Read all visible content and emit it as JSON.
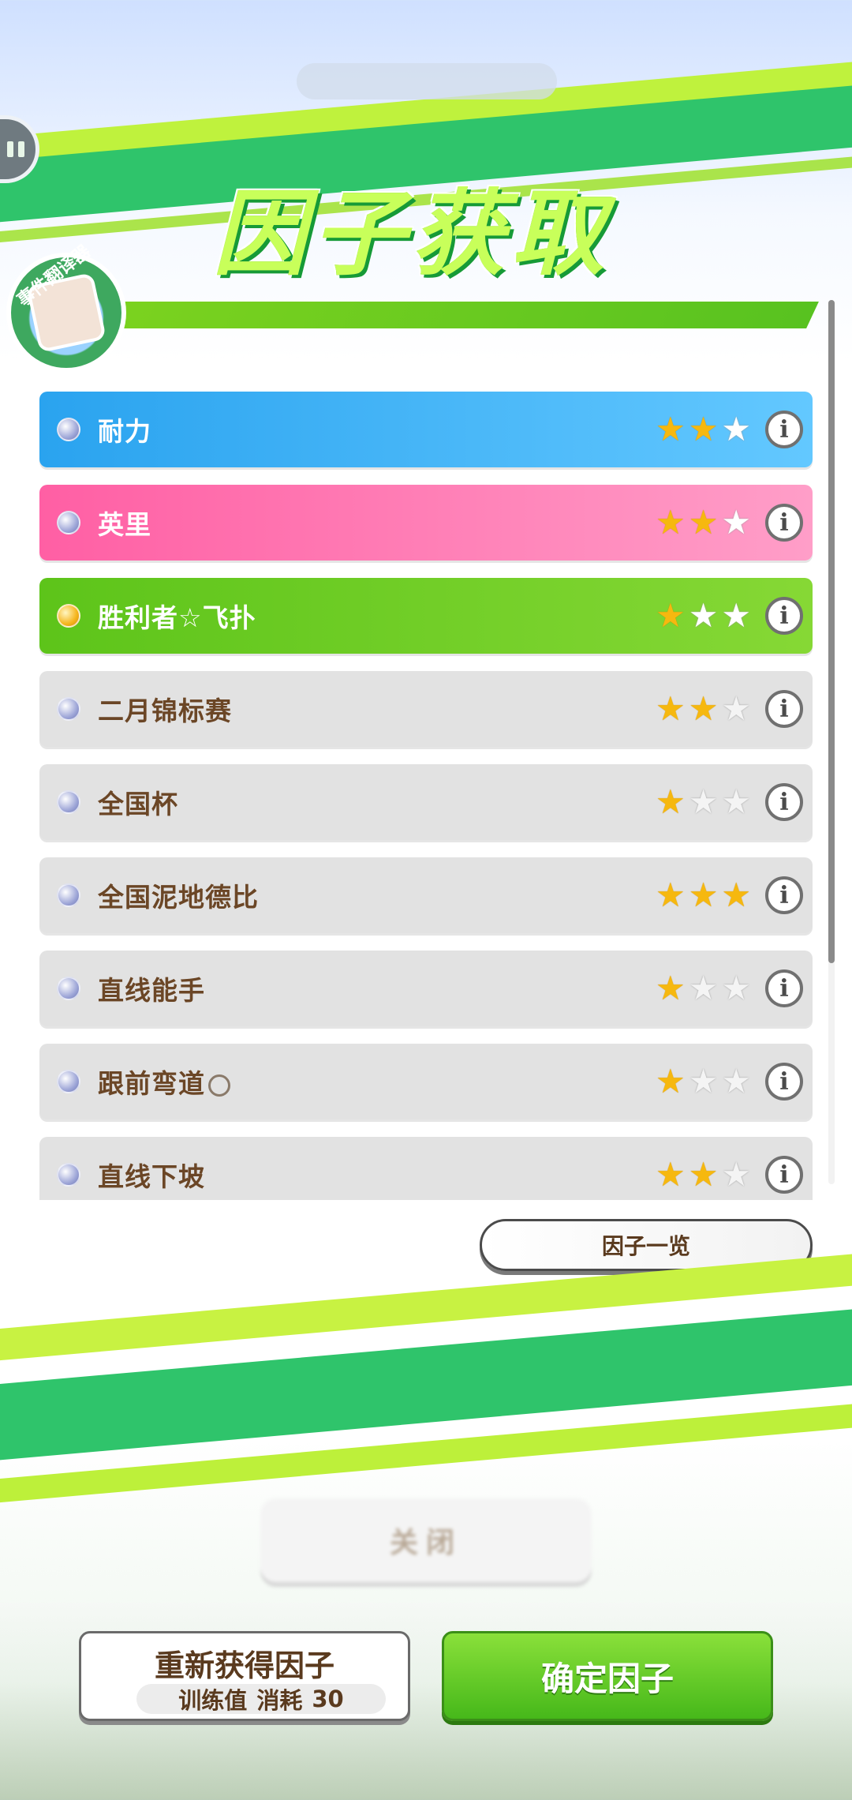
{
  "title": "因子获取",
  "badge": {
    "text": "事件翻译器"
  },
  "factors": [
    {
      "name": "耐力",
      "style": "blue",
      "dot": "silver",
      "stars": 2,
      "max_stars": 3
    },
    {
      "name": "英里",
      "style": "pink",
      "dot": "silver",
      "stars": 2,
      "max_stars": 3
    },
    {
      "name": "胜利者☆飞扑",
      "style": "green",
      "dot": "gold",
      "stars": 1,
      "max_stars": 3
    },
    {
      "name": "二月锦标赛",
      "style": "gray",
      "dot": "silver",
      "stars": 2,
      "max_stars": 3
    },
    {
      "name": "全国杯",
      "style": "gray",
      "dot": "silver",
      "stars": 1,
      "max_stars": 3
    },
    {
      "name": "全国泥地德比",
      "style": "gray",
      "dot": "silver",
      "stars": 3,
      "max_stars": 3
    },
    {
      "name": "直线能手",
      "style": "gray",
      "dot": "silver",
      "stars": 1,
      "max_stars": 3
    },
    {
      "name": "跟前弯道",
      "style": "gray",
      "dot": "silver",
      "stars": 1,
      "max_stars": 3,
      "suffix_icon": "circle-outline-icon"
    },
    {
      "name": "直线下坡",
      "style": "gray",
      "dot": "silver",
      "stars": 2,
      "max_stars": 3
    }
  ],
  "scroll_fraction_visible": 0.75,
  "factor_list_button": "因子一览",
  "ghost_close_label": "关闭",
  "reacquire": {
    "label": "重新获得因子",
    "cost_label": "训练值",
    "cost_word": "消耗",
    "cost_value": "30"
  },
  "confirm_label": "确定因子",
  "colors": {
    "green": "#5dc41a",
    "blue": "#2aa3ef",
    "pink": "#ff5fa4",
    "star": "#f6b80f"
  }
}
